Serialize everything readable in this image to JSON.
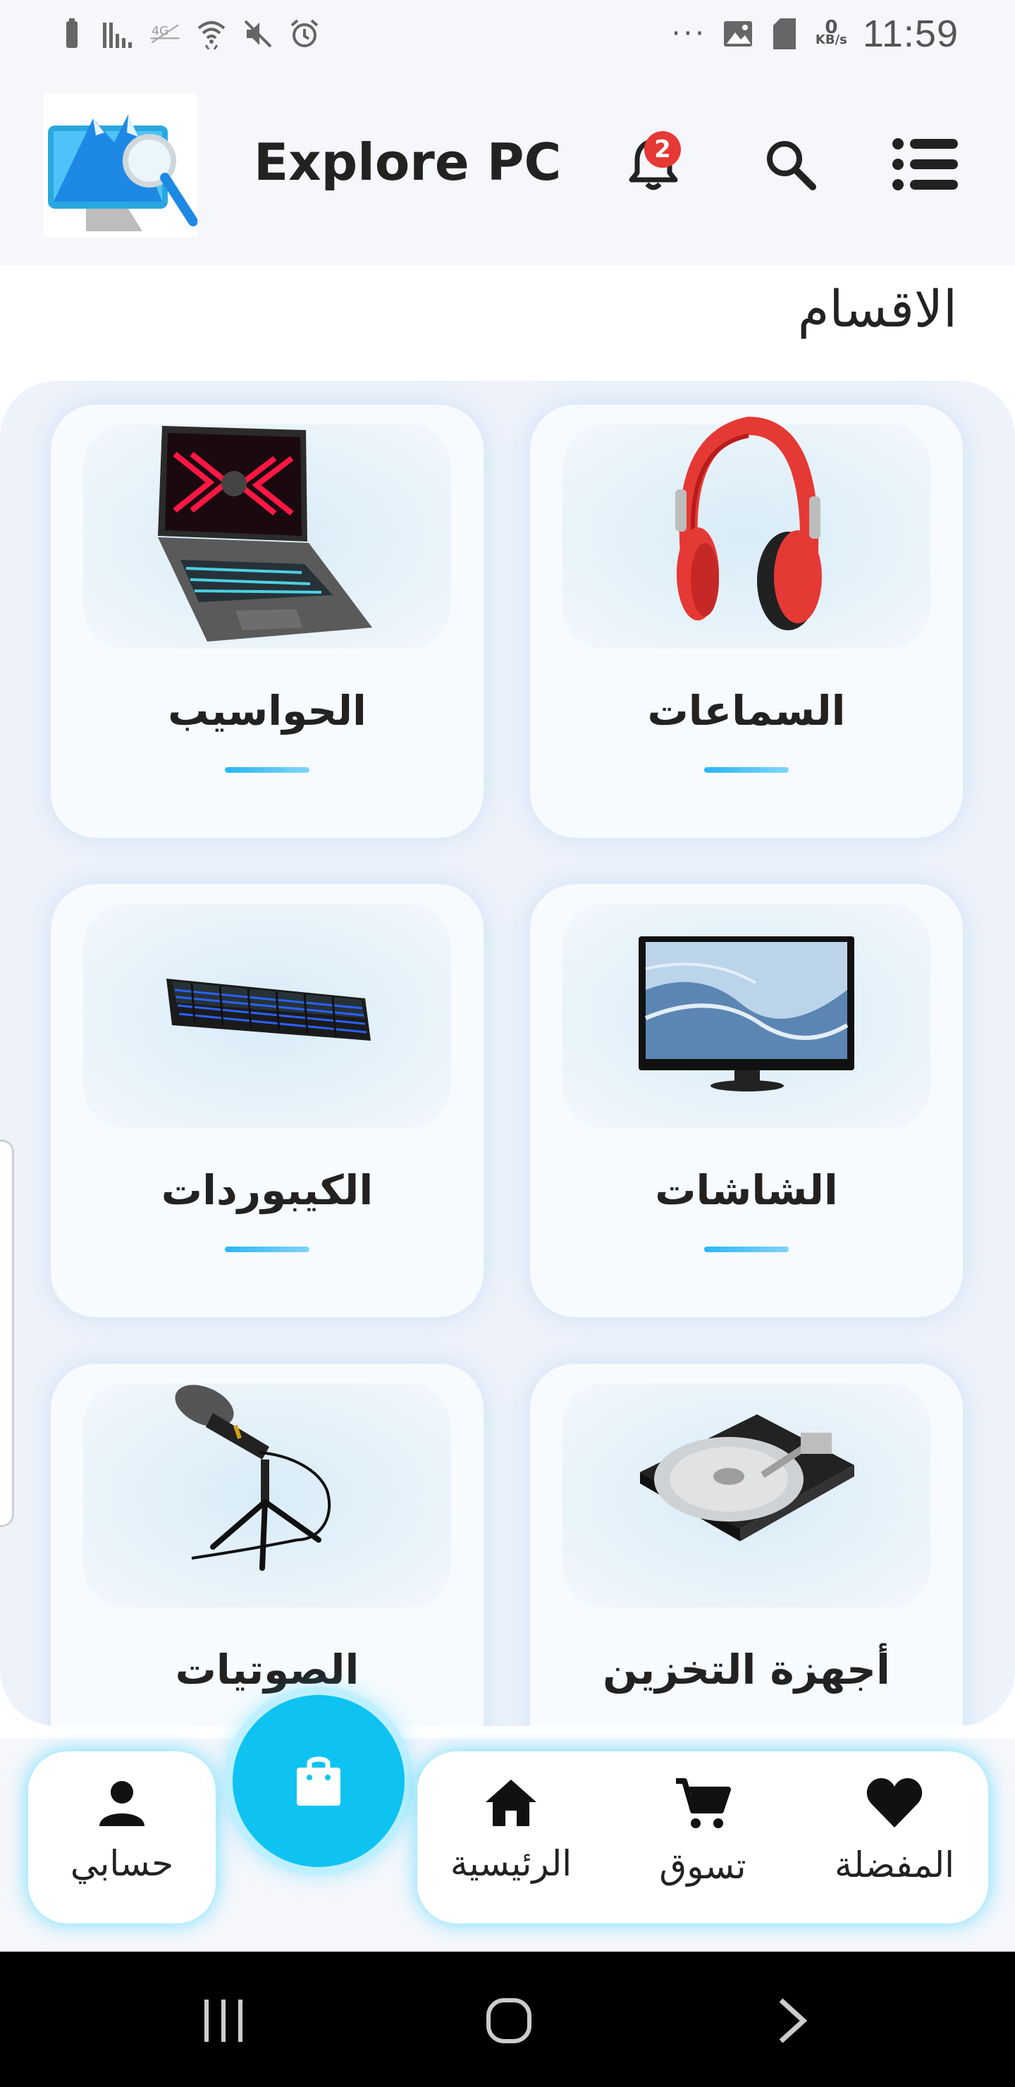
{
  "status_bar": {
    "time": "11:59",
    "net_speed_value": "0",
    "net_speed_unit": "KB/s",
    "more_indicator": "···",
    "icons": [
      "battery-icon",
      "signal-icon",
      "4g-icon",
      "wifi-icon",
      "mute-icon",
      "alarm-icon",
      "image-icon",
      "sim-icon"
    ]
  },
  "header": {
    "app_title": "Explore PC",
    "notification_count": "2",
    "icons": [
      "logo-image",
      "bell-icon",
      "search-icon",
      "menu-icon"
    ]
  },
  "section": {
    "title": "الاقسام"
  },
  "categories": [
    {
      "label": "السماعات",
      "icon": "headphones-image"
    },
    {
      "label": "الحواسيب",
      "icon": "laptop-image"
    },
    {
      "label": "الشاشات",
      "icon": "monitor-image"
    },
    {
      "label": "الكيبوردات",
      "icon": "keyboard-image"
    },
    {
      "label": "أجهزة التخزين",
      "icon": "hard-drive-image"
    },
    {
      "label": "الصوتيات",
      "icon": "microphone-image"
    }
  ],
  "bottom_nav": {
    "items": [
      {
        "label": "المفضلة",
        "icon": "heart-icon"
      },
      {
        "label": "تسوق",
        "icon": "cart-icon"
      },
      {
        "label": "الرئيسية",
        "icon": "home-icon"
      },
      {
        "label": "حسابي",
        "icon": "person-icon"
      }
    ],
    "fab_icon": "shopping-bag-icon",
    "accent_color": "#0ec3f2"
  },
  "system_nav": {
    "icons": [
      "recents-icon",
      "home-circle-icon",
      "back-chevron-icon"
    ]
  }
}
